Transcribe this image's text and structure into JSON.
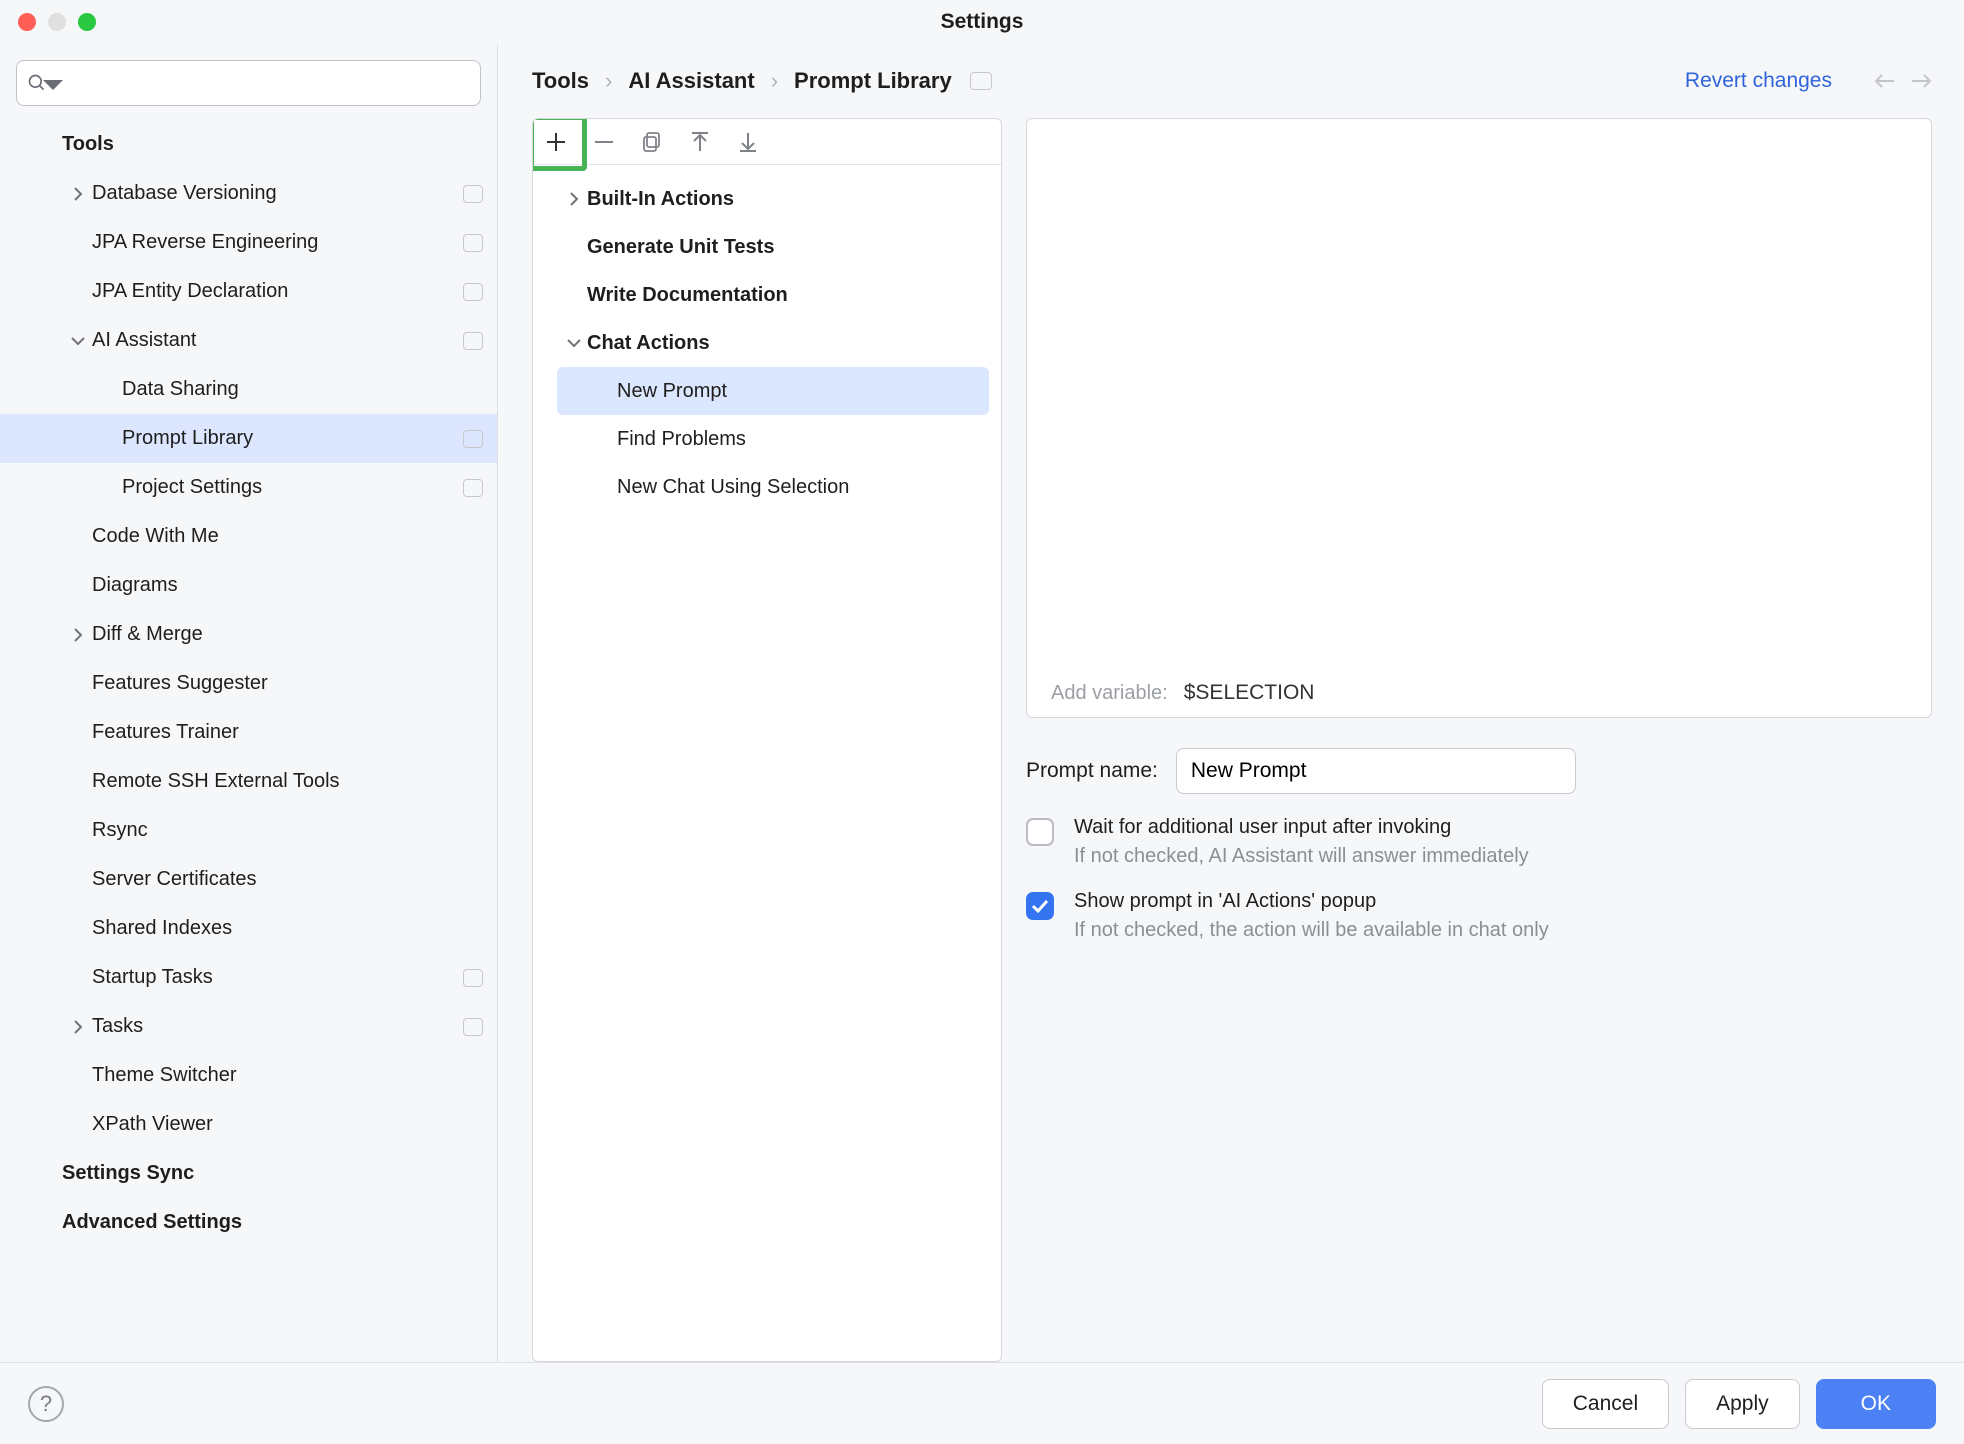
{
  "title": "Settings",
  "search_placeholder": "",
  "sidebar": [
    {
      "label": "Tools",
      "bold": true,
      "indent": 0,
      "chevron": "",
      "badge": false
    },
    {
      "label": "Database Versioning",
      "indent": 1,
      "chevron": "right",
      "badge": true
    },
    {
      "label": "JPA Reverse Engineering",
      "indent": 1,
      "chevron": "",
      "badge": true
    },
    {
      "label": "JPA Entity Declaration",
      "indent": 1,
      "chevron": "",
      "badge": true
    },
    {
      "label": "AI Assistant",
      "indent": 1,
      "chevron": "down",
      "badge": true
    },
    {
      "label": "Data Sharing",
      "indent": 2,
      "chevron": "",
      "badge": false
    },
    {
      "label": "Prompt Library",
      "indent": 2,
      "chevron": "",
      "badge": true,
      "selected": true
    },
    {
      "label": "Project Settings",
      "indent": 2,
      "chevron": "",
      "badge": true
    },
    {
      "label": "Code With Me",
      "indent": 1,
      "chevron": "",
      "badge": false
    },
    {
      "label": "Diagrams",
      "indent": 1,
      "chevron": "",
      "badge": false
    },
    {
      "label": "Diff & Merge",
      "indent": 1,
      "chevron": "right",
      "badge": false
    },
    {
      "label": "Features Suggester",
      "indent": 1,
      "chevron": "",
      "badge": false
    },
    {
      "label": "Features Trainer",
      "indent": 1,
      "chevron": "",
      "badge": false
    },
    {
      "label": "Remote SSH External Tools",
      "indent": 1,
      "chevron": "",
      "badge": false
    },
    {
      "label": "Rsync",
      "indent": 1,
      "chevron": "",
      "badge": false
    },
    {
      "label": "Server Certificates",
      "indent": 1,
      "chevron": "",
      "badge": false
    },
    {
      "label": "Shared Indexes",
      "indent": 1,
      "chevron": "",
      "badge": false
    },
    {
      "label": "Startup Tasks",
      "indent": 1,
      "chevron": "",
      "badge": true
    },
    {
      "label": "Tasks",
      "indent": 1,
      "chevron": "right",
      "badge": true
    },
    {
      "label": "Theme Switcher",
      "indent": 1,
      "chevron": "",
      "badge": false
    },
    {
      "label": "XPath Viewer",
      "indent": 1,
      "chevron": "",
      "badge": false
    },
    {
      "label": "Settings Sync",
      "bold": true,
      "indent": 0,
      "chevron": "",
      "badge": false
    },
    {
      "label": "Advanced Settings",
      "bold": true,
      "indent": 0,
      "chevron": "",
      "badge": false
    }
  ],
  "breadcrumbs": [
    "Tools",
    "AI Assistant",
    "Prompt Library"
  ],
  "revert_label": "Revert changes",
  "prompt_tree": [
    {
      "label": "Built-In Actions",
      "bold": true,
      "chevron": "right"
    },
    {
      "label": "Generate Unit Tests",
      "bold": true
    },
    {
      "label": "Write Documentation",
      "bold": true
    },
    {
      "label": "Chat Actions",
      "bold": true,
      "chevron": "down"
    },
    {
      "label": "New Prompt",
      "child": true,
      "selected": true
    },
    {
      "label": "Find Problems",
      "child": true
    },
    {
      "label": "New Chat Using Selection",
      "child": true
    }
  ],
  "add_variable_label": "Add variable:",
  "add_variable_value": "$SELECTION",
  "prompt_name_label": "Prompt name:",
  "prompt_name_value": "New Prompt",
  "wait_label": "Wait for additional user input after invoking",
  "wait_hint": "If not checked, AI Assistant will answer immediately",
  "wait_checked": false,
  "show_label": "Show prompt in 'AI Actions' popup",
  "show_hint": "If not checked, the action will be available in chat only",
  "show_checked": true,
  "buttons": {
    "cancel": "Cancel",
    "apply": "Apply",
    "ok": "OK"
  }
}
